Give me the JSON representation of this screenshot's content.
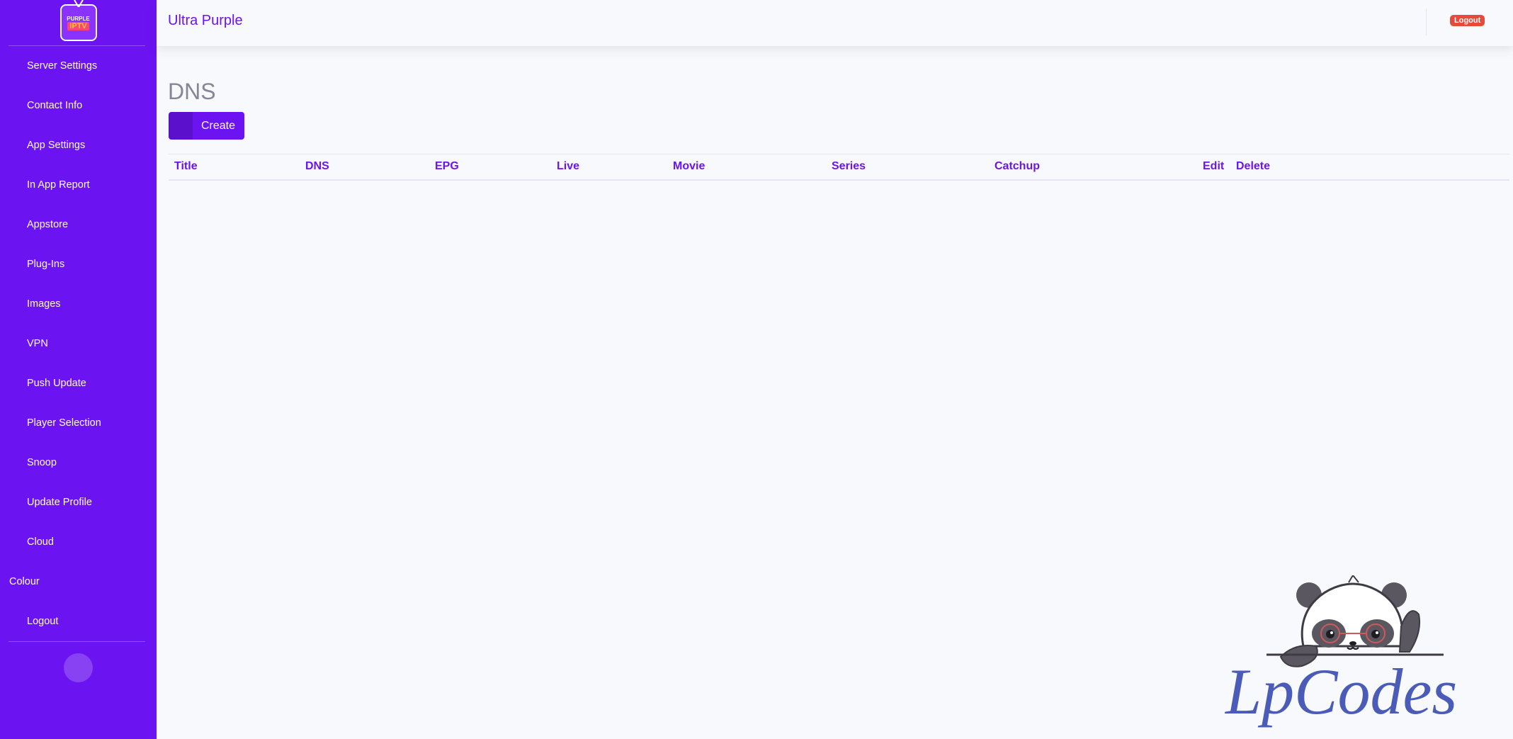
{
  "brand": {
    "logo_line1": "PURPLE",
    "logo_line2": "IPTV"
  },
  "sidebar": {
    "items": [
      {
        "label": "Server Settings",
        "icon": ""
      },
      {
        "label": "Contact Info",
        "icon": ""
      },
      {
        "label": "App Settings",
        "icon": ""
      },
      {
        "label": "In App Report",
        "icon": ""
      },
      {
        "label": "Appstore",
        "icon": ""
      },
      {
        "label": "Plug-Ins",
        "icon": ""
      },
      {
        "label": "Images",
        "icon": ""
      },
      {
        "label": "VPN",
        "icon": ""
      },
      {
        "label": "Push Update",
        "icon": ""
      },
      {
        "label": "Player Selection",
        "icon": ""
      },
      {
        "label": "Snoop",
        "icon": ""
      },
      {
        "label": "Update Profile",
        "icon": ""
      },
      {
        "label": "Cloud",
        "icon": "",
        "chevron": ""
      }
    ],
    "heading": "Colour",
    "logout": "Logout",
    "toggle_icon": ""
  },
  "topbar": {
    "title": "Ultra Purple",
    "logout_badge": "Logout",
    "user_caret": ""
  },
  "main": {
    "page_title": "DNS",
    "create_button": {
      "icon": "",
      "label": "Create"
    },
    "table": {
      "columns": [
        "Title",
        "DNS",
        "EPG",
        "Live",
        "Movie",
        "Series",
        "Catchup",
        "Edit",
        "Delete"
      ]
    }
  },
  "watermark": {
    "text": "LpCodes"
  },
  "colors": {
    "primary": "#6b13f0",
    "danger": "#e74a3b",
    "background": "#f8f9fc",
    "muted": "#858796"
  }
}
